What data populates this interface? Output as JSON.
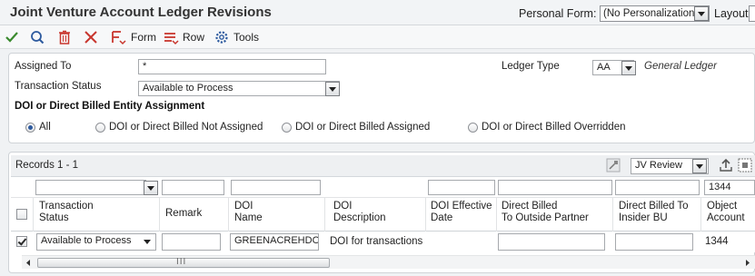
{
  "app": {
    "title": "Joint Venture Account Ledger Revisions"
  },
  "personal_form": {
    "label": "Personal Form:",
    "value": "(No Personalization)"
  },
  "layout": {
    "label": "Layout:"
  },
  "toolbar": {
    "form_label": "Form",
    "row_label": "Row",
    "tools_label": "Tools"
  },
  "filters": {
    "assigned_to_label": "Assigned To",
    "assigned_to_value": "*",
    "transaction_status_label": "Transaction Status",
    "transaction_status_value": "Available to Process",
    "ledger_type_label": "Ledger Type",
    "ledger_type_value": "AA",
    "ledger_type_desc": "General Ledger"
  },
  "doi_section": {
    "heading": "DOI or Direct Billed Entity Assignment",
    "options": [
      "All",
      "DOI or Direct Billed Not Assigned",
      "DOI or Direct Billed Assigned",
      "DOI or Direct Billed Overridden"
    ],
    "selected": "All"
  },
  "grid": {
    "records_label": "Records 1 - 1",
    "view_value": "JV Review",
    "object_filter_value": "1344",
    "columns": [
      "Transaction\nStatus",
      "Remark",
      "DOI\nName",
      "DOI\nDescription",
      "DOI Effective\nDate",
      "Direct Billed\nTo Outside Partner",
      "Direct Billed To\nInsider BU",
      "Object\nAccount"
    ],
    "row": {
      "transaction_status": "Available to Process",
      "remark": "",
      "doi_name": "GREENACREHDOI",
      "doi_description": "DOI for transactions",
      "doi_effective_date": "",
      "object_account": "1344"
    },
    "scroll_grip": "III"
  },
  "colors": {
    "accent": "#2d5a9e",
    "check_green": "#3a8a2e",
    "delete_red": "#c8362e"
  }
}
